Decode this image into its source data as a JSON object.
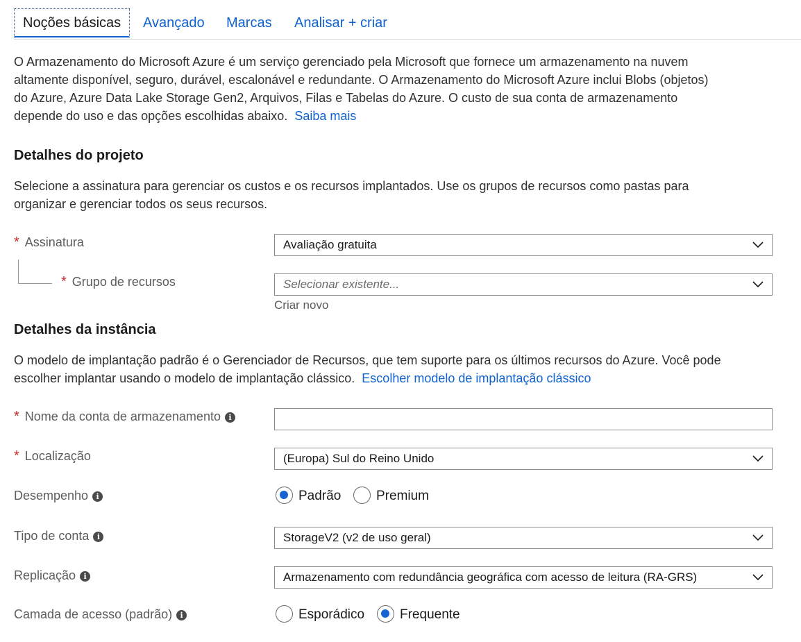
{
  "tabs": [
    {
      "label": "Noções básicas",
      "active": true
    },
    {
      "label": "Avançado",
      "active": false
    },
    {
      "label": "Marcas",
      "active": false
    },
    {
      "label": "Analisar + criar",
      "active": false
    }
  ],
  "intro": {
    "line1": "O Armazenamento do Microsoft Azure é um serviço gerenciado pela Microsoft que fornece um armazenamento na nuvem",
    "line2": "altamente disponível, seguro, durável, escalonável e redundante. O Armazenamento do Microsoft Azure inclui Blobs (objetos)",
    "line3": "do Azure, Azure Data Lake Storage Gen2, Arquivos, Filas e Tabelas do Azure. O custo de sua conta de armazenamento",
    "line4": "depende do uso e das opções escolhidas abaixo.",
    "link": "Saiba mais"
  },
  "project": {
    "heading": "Detalhes do projeto",
    "line1": "Selecione a assinatura para gerenciar os custos e os recursos implantados. Use os grupos de recursos como pastas para",
    "line2": "organizar e gerenciar todos os seus recursos.",
    "subscription": {
      "required": "*",
      "label": "Assinatura",
      "value": "Avaliação gratuita"
    },
    "resource_group": {
      "required": "*",
      "label": "Grupo de recursos",
      "placeholder": "Selecionar existente...",
      "create_link": "Criar novo"
    }
  },
  "instance": {
    "heading": "Detalhes da instância",
    "line1": "O modelo de implantação padrão é o Gerenciador de Recursos, que tem suporte para os últimos recursos do Azure. Você pode",
    "line2": "escolher implantar usando o modelo de implantação clássico.",
    "link": "Escolher modelo de implantação clássico",
    "storage_name": {
      "required": "*",
      "label": "Nome da conta de armazenamento",
      "value": ""
    },
    "location": {
      "required": "*",
      "label": "Localização",
      "value": "(Europa) Sul do Reino Unido"
    },
    "performance": {
      "label": "Desempenho",
      "options": [
        "Padrão",
        "Premium"
      ],
      "selected": "Padrão"
    },
    "account_type": {
      "label": "Tipo de conta",
      "value": "StorageV2 (v2 de uso geral)"
    },
    "replication": {
      "label": "Replicação",
      "value": "Armazenamento com redundância geográfica com acesso de leitura (RA-GRS)"
    },
    "access_tier": {
      "label": "Camada de acesso (padrão)",
      "options": [
        "Esporádico",
        "Frequente"
      ],
      "selected": "Frequente"
    }
  },
  "icons": {
    "info": "info-icon",
    "chevron": "chevron-down-icon",
    "info_glyph": "i"
  },
  "colors": {
    "link": "#0f62cf",
    "required": "#c4292a",
    "radio_selected": "#1763d3"
  }
}
